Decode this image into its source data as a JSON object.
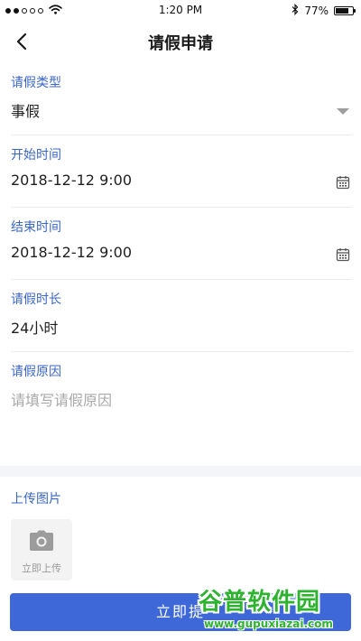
{
  "status_bar": {
    "time": "1:20 PM",
    "battery": "77%",
    "battery_level": 0.77,
    "signal_bars_filled": 2,
    "signal_bars_total": 5,
    "icons": [
      "signal-icon",
      "wifi-icon",
      "bluetooth-icon",
      "battery-icon"
    ]
  },
  "nav": {
    "title": "请假申请",
    "back_icon": "chevron-left-icon"
  },
  "form": {
    "leave_type": {
      "label": "请假类型",
      "value": "事假",
      "icon": "dropdown-arrow-icon"
    },
    "start_time": {
      "label": "开始时间",
      "value": "2018-12-12 9:00",
      "icon": "calendar-icon"
    },
    "end_time": {
      "label": "结束时间",
      "value": "2018-12-12 9:00",
      "icon": "calendar-icon"
    },
    "duration": {
      "label": "请假时长",
      "value": "24小时"
    },
    "reason": {
      "label": "请假原因",
      "placeholder": "请填写请假原因",
      "value": ""
    }
  },
  "upload": {
    "label": "上传图片",
    "button_text": "立即上传",
    "icon": "camera-icon"
  },
  "submit": {
    "label": "立即提"
  },
  "watermark": {
    "logo_text": "谷普软件园",
    "url": "www.gupuxiazai.com"
  },
  "colors": {
    "accent": "#3a66c8",
    "button": "#3e68d8",
    "placeholder": "#a8a8a8",
    "divider": "#ececec",
    "watermark": "#2db32f"
  }
}
